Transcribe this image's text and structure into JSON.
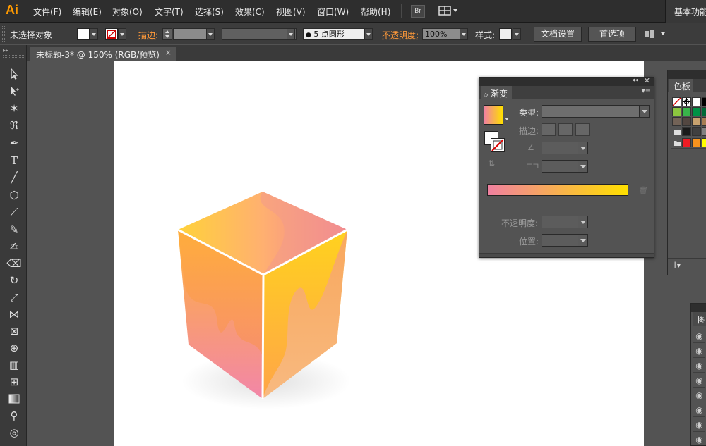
{
  "app": {
    "logo": "Ai",
    "brand_color": "#ff9a00"
  },
  "menu": {
    "items": [
      "文件(F)",
      "编辑(E)",
      "对象(O)",
      "文字(T)",
      "选择(S)",
      "效果(C)",
      "视图(V)",
      "窗口(W)",
      "帮助(H)"
    ],
    "bridge_label": "Br",
    "workspace": "基本功能"
  },
  "control_bar": {
    "selection_status": "未选择对象",
    "stroke_label": "描边:",
    "brush_value": "5 点圆形",
    "opacity_label": "不透明度:",
    "opacity_value": "100%",
    "style_label": "样式:",
    "doc_setup_button": "文档设置",
    "preferences_button": "首选项"
  },
  "document": {
    "tab_title": "未标题-3* @ 150% (RGB/预览)",
    "close": "×"
  },
  "gradient_panel": {
    "tab_label": "渐变",
    "type_label": "类型:",
    "stroke_label": "描边:",
    "opacity_label": "不透明度:",
    "position_label": "位置:",
    "gradient_start_color": "#f080a0",
    "gradient_end_color": "#ffe000"
  },
  "swatches_panel": {
    "tab_label": "色板"
  },
  "layers_panel": {
    "tab_label": "图"
  }
}
